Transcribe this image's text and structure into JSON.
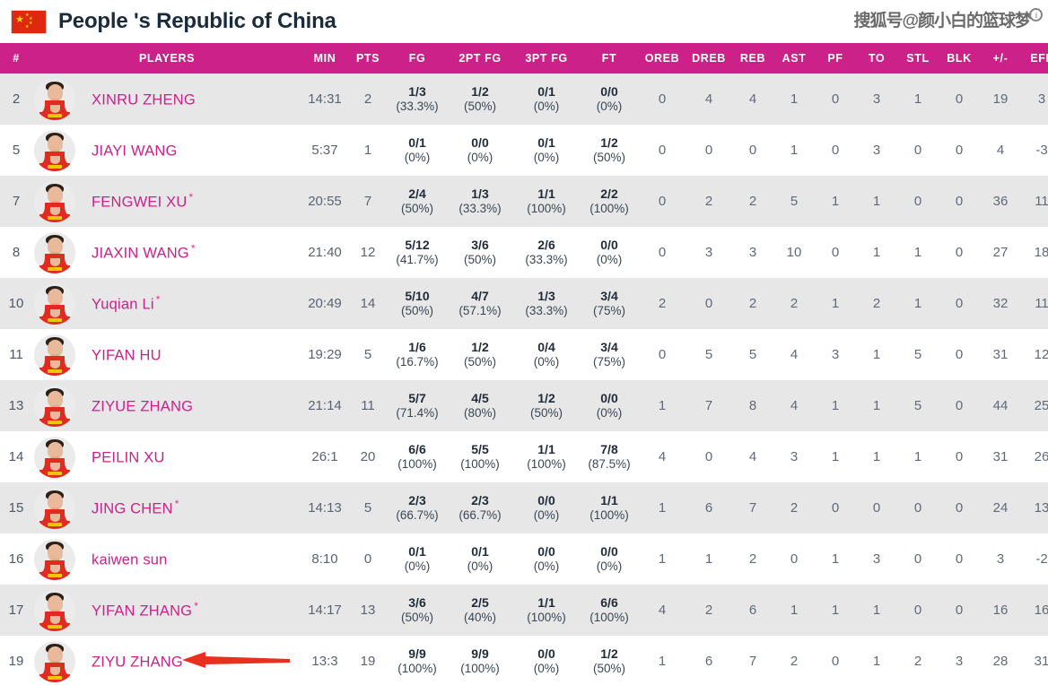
{
  "header": {
    "team_name": "People 's Republic of China",
    "flag_icon": "china-flag-icon",
    "watermark_text": "搜狐号@颜小白的篮球梦",
    "watermark_badge": "i"
  },
  "theme": {
    "header_bg": "#cc2189",
    "player_name_color": "#cc2189",
    "row_alt_bg": "#e7e7e7",
    "arrow_color": "#e8301f"
  },
  "table": {
    "columns": [
      "#",
      "PLAYERS",
      "MIN",
      "PTS",
      "FG",
      "2PT FG",
      "3PT FG",
      "FT",
      "OREB",
      "DREB",
      "REB",
      "AST",
      "PF",
      "TO",
      "STL",
      "BLK",
      "+/-",
      "EFF"
    ],
    "rows": [
      {
        "number": "2",
        "name": "XINRU ZHENG",
        "starter": "",
        "min": "14:31",
        "pts": "2",
        "fg": "1/3",
        "fg_pct": "(33.3%)",
        "fg2": "1/2",
        "fg2_pct": "(50%)",
        "fg3": "0/1",
        "fg3_pct": "(0%)",
        "ft": "0/0",
        "ft_pct": "(0%)",
        "oreb": "0",
        "dreb": "4",
        "reb": "4",
        "ast": "1",
        "pf": "0",
        "to": "3",
        "stl": "1",
        "blk": "0",
        "pm": "19",
        "eff": "3"
      },
      {
        "number": "5",
        "name": "JIAYI WANG",
        "starter": "",
        "min": "5:37",
        "pts": "1",
        "fg": "0/1",
        "fg_pct": "(0%)",
        "fg2": "0/0",
        "fg2_pct": "(0%)",
        "fg3": "0/1",
        "fg3_pct": "(0%)",
        "ft": "1/2",
        "ft_pct": "(50%)",
        "oreb": "0",
        "dreb": "0",
        "reb": "0",
        "ast": "1",
        "pf": "0",
        "to": "3",
        "stl": "0",
        "blk": "0",
        "pm": "4",
        "eff": "-3"
      },
      {
        "number": "7",
        "name": "FENGWEI XU",
        "starter": "*",
        "min": "20:55",
        "pts": "7",
        "fg": "2/4",
        "fg_pct": "(50%)",
        "fg2": "1/3",
        "fg2_pct": "(33.3%)",
        "fg3": "1/1",
        "fg3_pct": "(100%)",
        "ft": "2/2",
        "ft_pct": "(100%)",
        "oreb": "0",
        "dreb": "2",
        "reb": "2",
        "ast": "5",
        "pf": "1",
        "to": "1",
        "stl": "0",
        "blk": "0",
        "pm": "36",
        "eff": "11"
      },
      {
        "number": "8",
        "name": "JIAXIN WANG",
        "starter": "*",
        "min": "21:40",
        "pts": "12",
        "fg": "5/12",
        "fg_pct": "(41.7%)",
        "fg2": "3/6",
        "fg2_pct": "(50%)",
        "fg3": "2/6",
        "fg3_pct": "(33.3%)",
        "ft": "0/0",
        "ft_pct": "(0%)",
        "oreb": "0",
        "dreb": "3",
        "reb": "3",
        "ast": "10",
        "pf": "0",
        "to": "1",
        "stl": "1",
        "blk": "0",
        "pm": "27",
        "eff": "18"
      },
      {
        "number": "10",
        "name": "Yuqian Li",
        "starter": "*",
        "min": "20:49",
        "pts": "14",
        "fg": "5/10",
        "fg_pct": "(50%)",
        "fg2": "4/7",
        "fg2_pct": "(57.1%)",
        "fg3": "1/3",
        "fg3_pct": "(33.3%)",
        "ft": "3/4",
        "ft_pct": "(75%)",
        "oreb": "2",
        "dreb": "0",
        "reb": "2",
        "ast": "2",
        "pf": "1",
        "to": "2",
        "stl": "1",
        "blk": "0",
        "pm": "32",
        "eff": "11"
      },
      {
        "number": "11",
        "name": "YIFAN HU",
        "starter": "",
        "min": "19:29",
        "pts": "5",
        "fg": "1/6",
        "fg_pct": "(16.7%)",
        "fg2": "1/2",
        "fg2_pct": "(50%)",
        "fg3": "0/4",
        "fg3_pct": "(0%)",
        "ft": "3/4",
        "ft_pct": "(75%)",
        "oreb": "0",
        "dreb": "5",
        "reb": "5",
        "ast": "4",
        "pf": "3",
        "to": "1",
        "stl": "5",
        "blk": "0",
        "pm": "31",
        "eff": "12"
      },
      {
        "number": "13",
        "name": "ZIYUE ZHANG",
        "starter": "",
        "min": "21:14",
        "pts": "11",
        "fg": "5/7",
        "fg_pct": "(71.4%)",
        "fg2": "4/5",
        "fg2_pct": "(80%)",
        "fg3": "1/2",
        "fg3_pct": "(50%)",
        "ft": "0/0",
        "ft_pct": "(0%)",
        "oreb": "1",
        "dreb": "7",
        "reb": "8",
        "ast": "4",
        "pf": "1",
        "to": "1",
        "stl": "5",
        "blk": "0",
        "pm": "44",
        "eff": "25"
      },
      {
        "number": "14",
        "name": "PEILIN XU",
        "starter": "",
        "min": "26:1",
        "pts": "20",
        "fg": "6/6",
        "fg_pct": "(100%)",
        "fg2": "5/5",
        "fg2_pct": "(100%)",
        "fg3": "1/1",
        "fg3_pct": "(100%)",
        "ft": "7/8",
        "ft_pct": "(87.5%)",
        "oreb": "4",
        "dreb": "0",
        "reb": "4",
        "ast": "3",
        "pf": "1",
        "to": "1",
        "stl": "1",
        "blk": "0",
        "pm": "31",
        "eff": "26"
      },
      {
        "number": "15",
        "name": "JING CHEN",
        "starter": "*",
        "min": "14:13",
        "pts": "5",
        "fg": "2/3",
        "fg_pct": "(66.7%)",
        "fg2": "2/3",
        "fg2_pct": "(66.7%)",
        "fg3": "0/0",
        "fg3_pct": "(0%)",
        "ft": "1/1",
        "ft_pct": "(100%)",
        "oreb": "1",
        "dreb": "6",
        "reb": "7",
        "ast": "2",
        "pf": "0",
        "to": "0",
        "stl": "0",
        "blk": "0",
        "pm": "24",
        "eff": "13"
      },
      {
        "number": "16",
        "name": "kaiwen sun",
        "starter": "",
        "min": "8:10",
        "pts": "0",
        "fg": "0/1",
        "fg_pct": "(0%)",
        "fg2": "0/1",
        "fg2_pct": "(0%)",
        "fg3": "0/0",
        "fg3_pct": "(0%)",
        "ft": "0/0",
        "ft_pct": "(0%)",
        "oreb": "1",
        "dreb": "1",
        "reb": "2",
        "ast": "0",
        "pf": "1",
        "to": "3",
        "stl": "0",
        "blk": "0",
        "pm": "3",
        "eff": "-2"
      },
      {
        "number": "17",
        "name": "YIFAN ZHANG",
        "starter": "*",
        "min": "14:17",
        "pts": "13",
        "fg": "3/6",
        "fg_pct": "(50%)",
        "fg2": "2/5",
        "fg2_pct": "(40%)",
        "fg3": "1/1",
        "fg3_pct": "(100%)",
        "ft": "6/6",
        "ft_pct": "(100%)",
        "oreb": "4",
        "dreb": "2",
        "reb": "6",
        "ast": "1",
        "pf": "1",
        "to": "1",
        "stl": "0",
        "blk": "0",
        "pm": "16",
        "eff": "16"
      },
      {
        "number": "19",
        "name": "ZIYU ZHANG",
        "starter": "",
        "min": "13:3",
        "pts": "19",
        "fg": "9/9",
        "fg_pct": "(100%)",
        "fg2": "9/9",
        "fg2_pct": "(100%)",
        "fg3": "0/0",
        "fg3_pct": "(0%)",
        "ft": "1/2",
        "ft_pct": "(50%)",
        "oreb": "1",
        "dreb": "6",
        "reb": "7",
        "ast": "2",
        "pf": "0",
        "to": "1",
        "stl": "2",
        "blk": "3",
        "pm": "28",
        "eff": "31"
      }
    ]
  },
  "annotation": {
    "arrow_icon": "red-left-arrow-icon",
    "target_row": "ZIYU ZHANG"
  }
}
